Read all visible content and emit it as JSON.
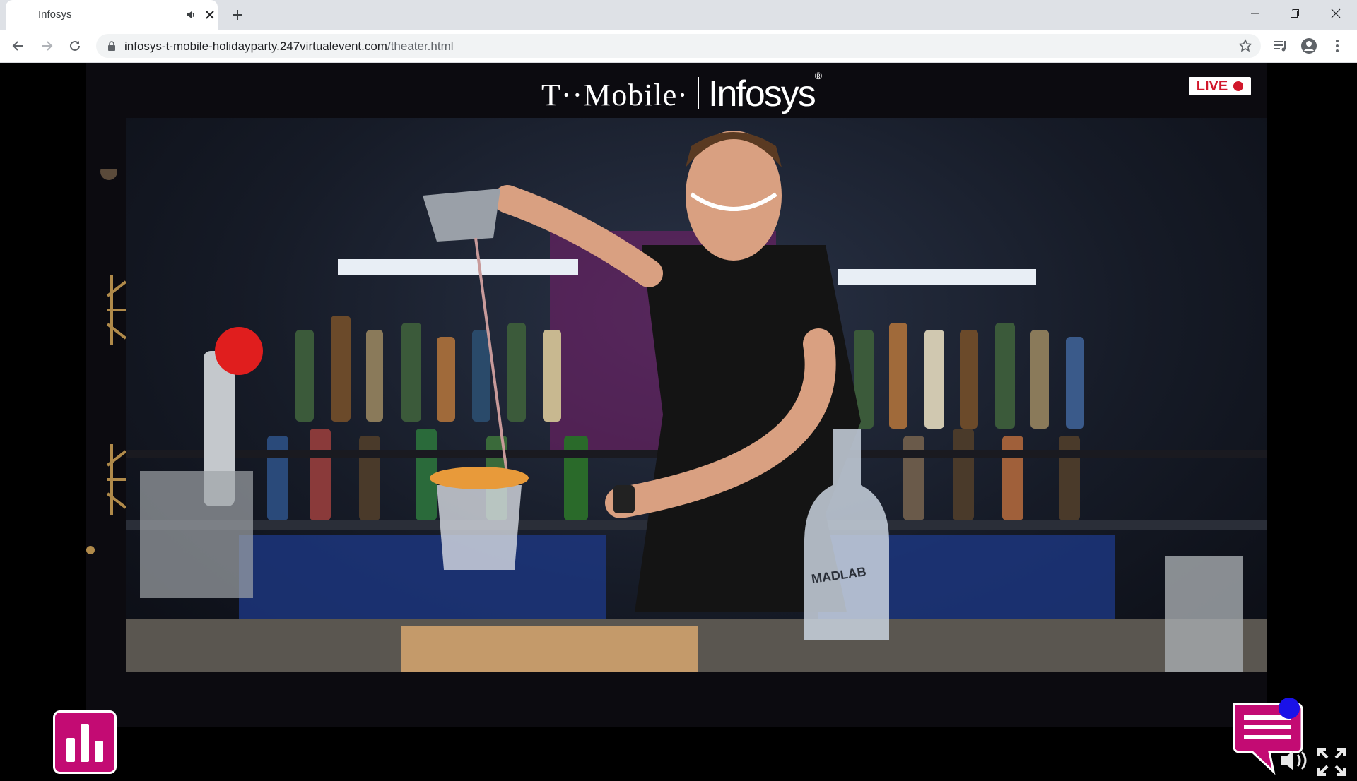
{
  "browser": {
    "tab": {
      "title": "Infosys"
    },
    "url": {
      "host": "infosys-t-mobile-holidayparty.247virtualevent.com",
      "path": "/theater.html"
    }
  },
  "page": {
    "brand": {
      "left": "T··Mobile·",
      "right": "Infosys",
      "right_mark": "®"
    },
    "live_badge": "LIVE",
    "video": {
      "subject": "bartender pouring a cocktail at a backlit bar",
      "bottle_label": "MADLAB"
    }
  },
  "icons": {
    "tab": [
      "speaker-icon",
      "close-icon",
      "plus-icon"
    ],
    "window": [
      "minimize-icon",
      "restore-icon",
      "close-icon"
    ],
    "nav": [
      "back-arrow-icon",
      "forward-arrow-icon",
      "reload-icon",
      "lock-icon",
      "star-icon",
      "media-control-icon",
      "profile-icon",
      "more-vert-icon"
    ],
    "page": [
      "poll-bar-chart-icon",
      "chat-bubble-icon",
      "volume-icon",
      "fullscreen-icon"
    ]
  },
  "colors": {
    "accent_magenta": "#c30b73",
    "live_red": "#d1172b",
    "stage_bg": "#0c0b10",
    "notification_dot": "#1a12e8"
  }
}
